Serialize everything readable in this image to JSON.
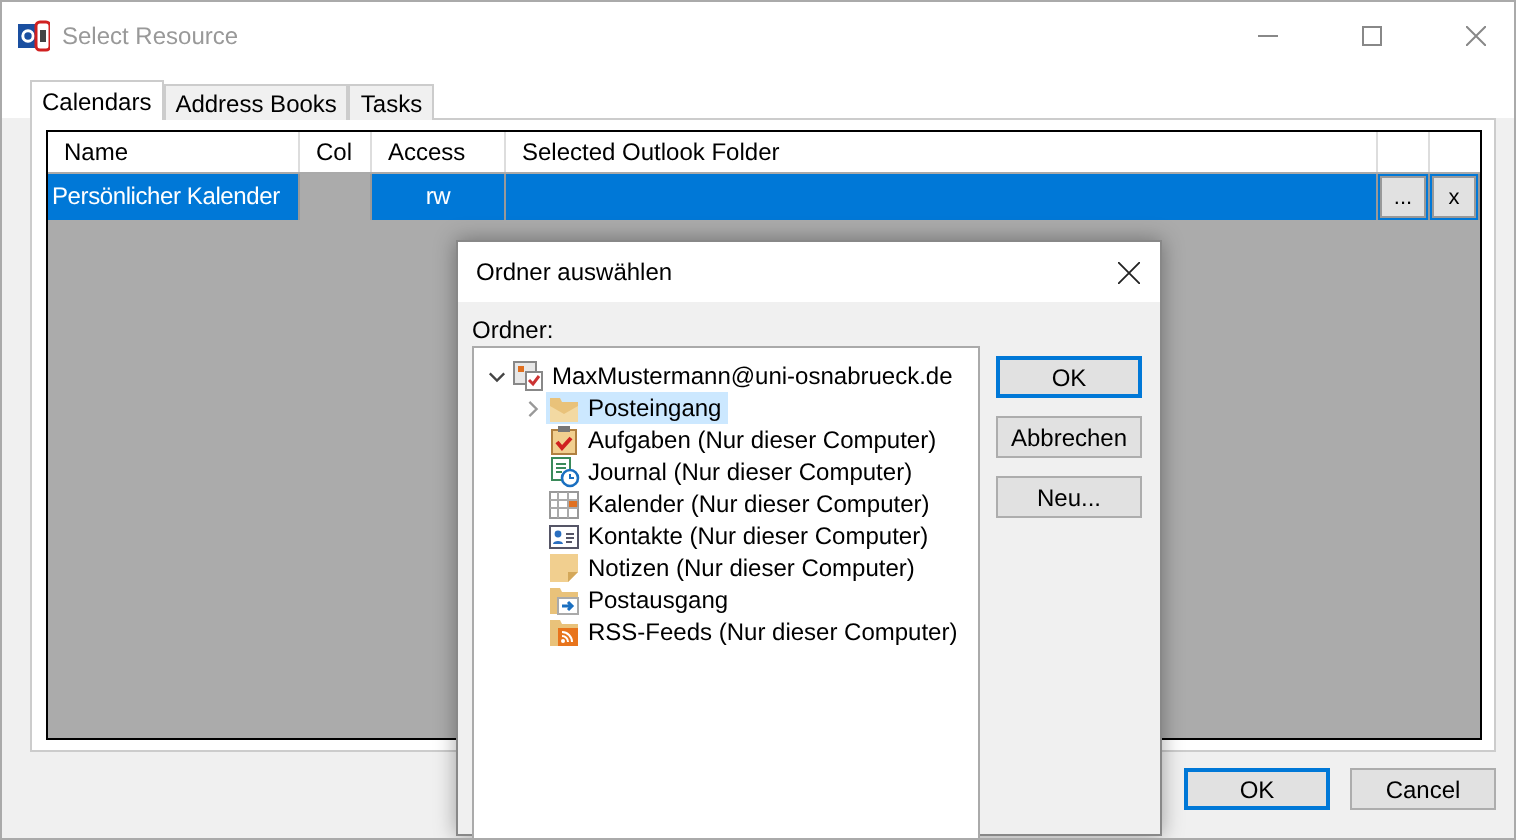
{
  "window": {
    "title": "Select Resource"
  },
  "tabs": [
    {
      "label": "Calendars",
      "selected": true
    },
    {
      "label": "Address Books",
      "selected": false
    },
    {
      "label": "Tasks",
      "selected": false
    }
  ],
  "table": {
    "columns": [
      "Name",
      "Col",
      "Access",
      "Selected Outlook Folder"
    ],
    "rows": [
      {
        "name": "Persönlicher Kalender",
        "access": "rw",
        "selected": true,
        "browse_button": "...",
        "clear_button": "x"
      }
    ]
  },
  "buttons": [
    {
      "label": "OK",
      "default": true
    },
    {
      "label": "Cancel",
      "default": false
    }
  ],
  "dialog": {
    "title": "Ordner auswählen",
    "label": "Ordner:",
    "tree": [
      {
        "label": "MaxMustermann@uni-osnabrueck.de",
        "kind": "account",
        "expanded": true,
        "selected": false,
        "children": [
          {
            "label": "Posteingang",
            "kind": "inbox",
            "expanded": false,
            "has_children": true,
            "selected": true
          },
          {
            "label": "Aufgaben (Nur dieser Computer)",
            "kind": "tasks",
            "selected": false
          },
          {
            "label": "Journal (Nur dieser Computer)",
            "kind": "journal",
            "selected": false
          },
          {
            "label": "Kalender (Nur dieser Computer)",
            "kind": "calendar",
            "selected": false
          },
          {
            "label": "Kontakte (Nur dieser Computer)",
            "kind": "contacts",
            "selected": false
          },
          {
            "label": "Notizen (Nur dieser Computer)",
            "kind": "notes",
            "selected": false
          },
          {
            "label": "Postausgang",
            "kind": "outbox",
            "selected": false
          },
          {
            "label": "RSS-Feeds (Nur dieser Computer)",
            "kind": "rss",
            "selected": false
          }
        ]
      }
    ],
    "buttons": [
      {
        "label": "OK",
        "default": true
      },
      {
        "label": "Abbrechen",
        "default": false
      },
      {
        "label": "Neu...",
        "default": false
      }
    ]
  }
}
